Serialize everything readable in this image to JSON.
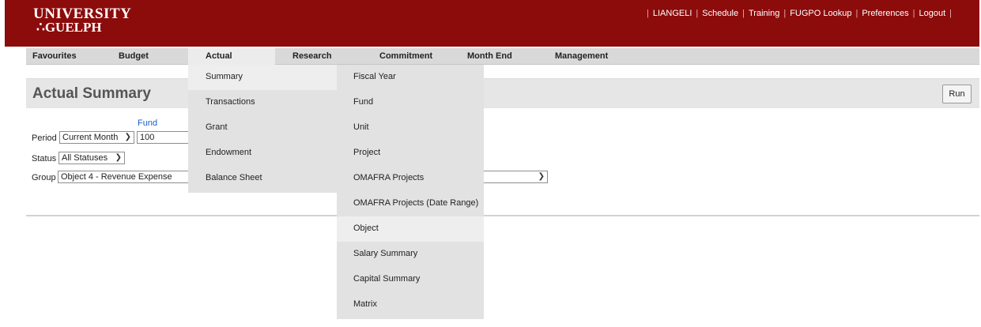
{
  "header": {
    "logo_line1": "UNIVERSITY",
    "logo_line2": "∴GUELPH",
    "links": [
      "LIANGELI",
      "Schedule",
      "Training",
      "FUGPO Lookup",
      "Preferences",
      "Logout"
    ]
  },
  "nav": {
    "items": [
      "Favourites",
      "Budget",
      "Actual",
      "Research",
      "Commitment",
      "Month End",
      "Management"
    ],
    "active": "Actual"
  },
  "page": {
    "title": "Actual Summary",
    "run_label": "Run"
  },
  "form": {
    "fund_link": "Fund",
    "period_label": "Period",
    "period_value": "Current Month",
    "fund_value": "100",
    "status_label": "Status",
    "status_value": "All Statuses",
    "group_label": "Group",
    "group_value": "Object 4 - Revenue Expense"
  },
  "menu": {
    "actual_items": [
      "Summary",
      "Transactions",
      "Grant",
      "Endowment",
      "Balance Sheet"
    ],
    "summary_items": [
      "Fiscal Year",
      "Fund",
      "Unit",
      "Project",
      "OMAFRA Projects",
      "OMAFRA Projects (Date Range)",
      "Object",
      "Salary Summary",
      "Capital Summary",
      "Matrix"
    ]
  },
  "colors": {
    "header_bg": "#8c0b0b",
    "nav_bg": "#d9d9d9",
    "menu_bg": "#e2e2e2",
    "menu_highlight": "#eeeeee",
    "fund_link": "#1a5fc8"
  }
}
